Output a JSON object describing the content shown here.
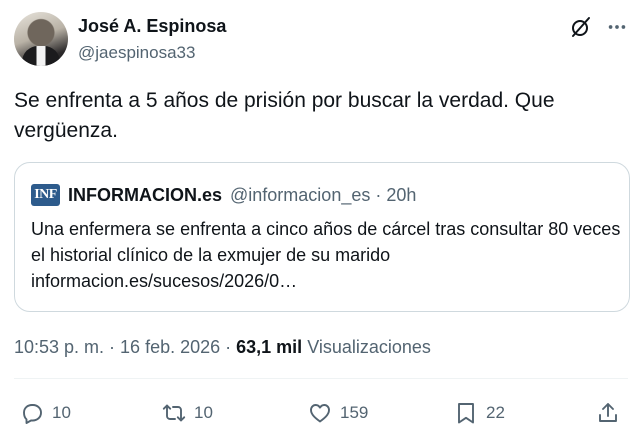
{
  "author": {
    "display_name": "José A. Espinosa",
    "handle": "@jaespinosa33"
  },
  "tweet": {
    "text": "Se enfrenta a 5 años de prisión por buscar la verdad. Que vergüenza."
  },
  "quote": {
    "logo_text": "INF",
    "source_name": "INFORMACION.es",
    "source_meta": "@informacion_es · 20h",
    "text": "Una enfermera se enfrenta a cinco años de cárcel tras consultar 80 veces el historial clínico de la exmujer de su marido informacion.es/sucesos/2026/0…"
  },
  "meta": {
    "time_date": "10:53 p. m. · 16 feb. 2026 · ",
    "views_count": "63,1 mil",
    "views_label": " Visualizaciones"
  },
  "actions": {
    "replies": "10",
    "reposts": "10",
    "likes": "159",
    "bookmarks": "22"
  },
  "icons": {
    "grok": "grok-icon",
    "more": "more-horizontal-icon",
    "reply": "reply-icon",
    "repost": "repost-icon",
    "like": "heart-icon",
    "bookmark": "bookmark-icon",
    "share": "share-icon"
  },
  "colors": {
    "text_primary": "#0f1419",
    "text_secondary": "#536471",
    "border": "#cfd9de",
    "logo_bg": "#2d5b8c"
  }
}
